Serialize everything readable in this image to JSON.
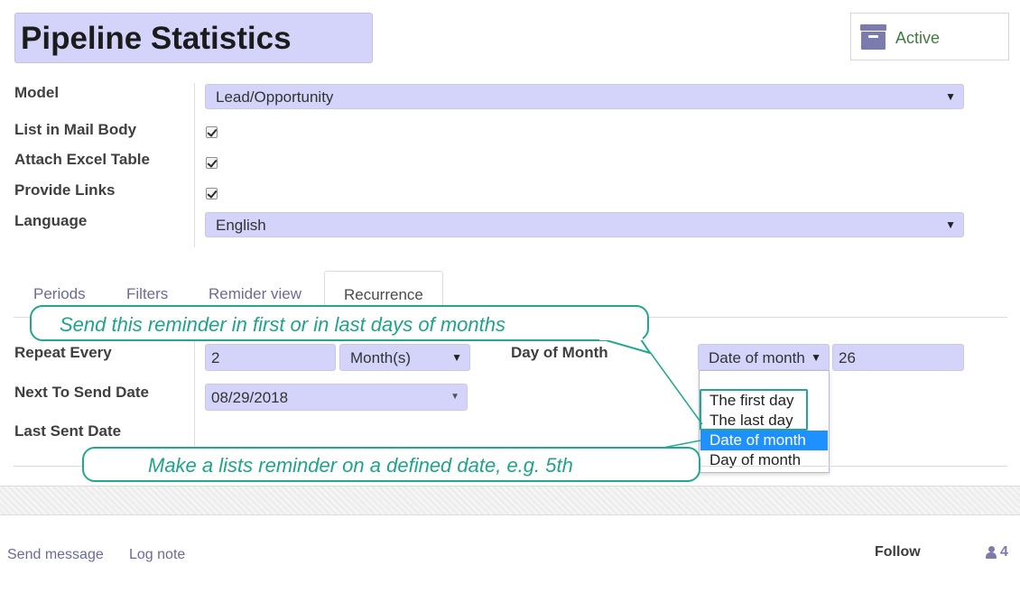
{
  "record": {
    "title": "Pipeline Statistics",
    "active_label": "Active"
  },
  "fields": {
    "model": {
      "label": "Model",
      "value": "Lead/Opportunity"
    },
    "list_in_mail_body": {
      "label": "List in Mail Body",
      "checked": true
    },
    "attach_excel_table": {
      "label": "Attach Excel Table",
      "checked": true
    },
    "provide_links": {
      "label": "Provide Links",
      "checked": true
    },
    "language": {
      "label": "Language",
      "value": "English"
    }
  },
  "tabs": [
    {
      "label": "Periods",
      "active": false
    },
    {
      "label": "Filters",
      "active": false
    },
    {
      "label": "Remider view",
      "active": false
    },
    {
      "label": "Recurrence",
      "active": true
    }
  ],
  "recurrence": {
    "repeat_every": {
      "label": "Repeat Every",
      "value": "2",
      "unit": "Month(s)"
    },
    "next_to_send_date": {
      "label": "Next To Send Date",
      "value": "08/29/2018"
    },
    "last_sent_date": {
      "label": "Last Sent Date",
      "value": ""
    },
    "day_of_month": {
      "label": "Day of Month",
      "mode": "Date of month",
      "value": "26",
      "options": [
        "The first day",
        "The last day",
        "Date of month",
        "Day of month"
      ],
      "selected_option": "Date of month"
    }
  },
  "annotations": {
    "top_callout": "Send this reminder in first or  in  last days of months",
    "bottom_callout": "Make a lists reminder on a defined date, e.g. 5th",
    "color": "#22a88f"
  },
  "chatter": {
    "send_message": "Send message",
    "log_note": "Log note",
    "follow": "Follow",
    "followers_count": "4"
  },
  "colors": {
    "field_bg": "#d4d4fb",
    "accent": "#7c7bad",
    "active_green": "#3f7b3f",
    "dropdown_selected": "#1e90ff"
  },
  "icons": [
    "archive-icon",
    "checkbox-checked-icon",
    "caret-down-icon",
    "user-icon"
  ]
}
